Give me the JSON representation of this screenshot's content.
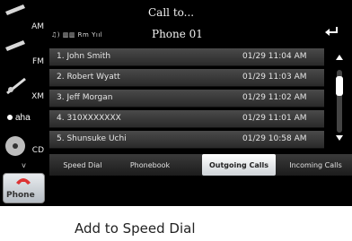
{
  "header": {
    "title": "Call to...",
    "subtitle": "Phone 01",
    "status": "♫) ▥▥ Rm Yııl"
  },
  "sources": {
    "am": "AM",
    "fm": "FM",
    "xm": "XM",
    "aha": "aha",
    "cd": "CD",
    "more": "v",
    "phone": "Phone"
  },
  "calls": [
    {
      "name": "1. John Smith",
      "time": "01/29 11:04 AM"
    },
    {
      "name": "2. Robert Wyatt",
      "time": "01/29 11:03 AM"
    },
    {
      "name": "3. Jeff Morgan",
      "time": "01/29 11:02 AM"
    },
    {
      "name": "4. 310XXXXXXX",
      "time": "01/29 11:01 AM"
    },
    {
      "name": "5. Shunsuke Uchi",
      "time": "01/29 10:58 AM"
    }
  ],
  "tabs": {
    "speed_dial": "Speed Dial",
    "phonebook": "Phonebook",
    "outgoing": "Outgoing Calls",
    "incoming": "Incoming Calls"
  },
  "active_tab": "Outgoing Calls",
  "scroll": {
    "position_fraction": 0.15
  },
  "caption": "Add to Speed Dial"
}
